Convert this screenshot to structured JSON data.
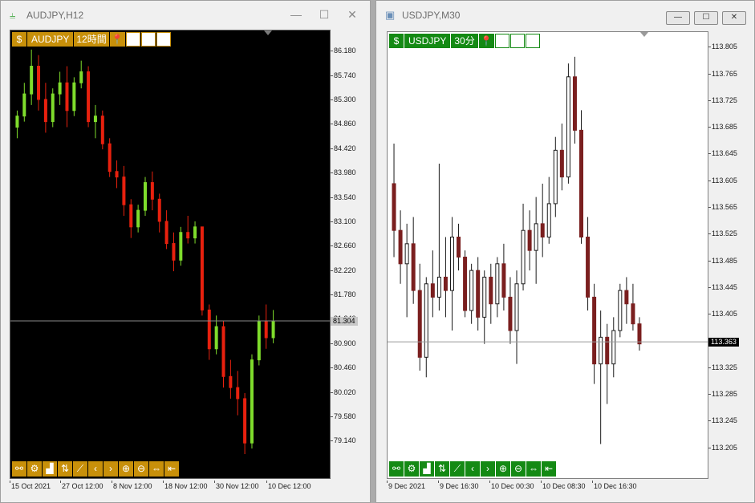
{
  "windows": [
    {
      "title": "AUDJPY,H12",
      "symbol": "AUDJPY",
      "timeframe": "12時間",
      "current_price": "81.304",
      "y_labels": [
        "86.180",
        "85.740",
        "85.300",
        "84.860",
        "84.420",
        "83.980",
        "83.540",
        "83.100",
        "82.660",
        "82.220",
        "81.780",
        "81.340",
        "80.900",
        "80.460",
        "80.020",
        "79.580",
        "79.140"
      ],
      "x_labels": [
        "15 Oct 2021",
        "27 Oct 12:00",
        "8 Nov 12:00",
        "18 Nov 12:00",
        "30 Nov 12:00",
        "10 Dec 12:00"
      ],
      "colors": {
        "bull": "#7fdc2c",
        "bear": "#e8210e",
        "bg": "#000000",
        "panel": "#c8900a"
      }
    },
    {
      "title": "USDJPY,M30",
      "symbol": "USDJPY",
      "timeframe": "30分",
      "current_price": "113.363",
      "y_labels": [
        "113.805",
        "113.765",
        "113.725",
        "113.685",
        "113.645",
        "113.605",
        "113.565",
        "113.525",
        "113.485",
        "113.445",
        "113.405",
        "113.365",
        "113.325",
        "113.285",
        "113.245",
        "113.205"
      ],
      "x_labels": [
        "9 Dec 2021",
        "9 Dec 16:30",
        "10 Dec 00:30",
        "10 Dec 08:30",
        "10 Dec 16:30"
      ],
      "colors": {
        "bull": "#ffffff",
        "bear": "#7a1f1f",
        "bg": "#ffffff",
        "panel": "#148a14"
      }
    }
  ],
  "window_controls": {
    "minimize": "—",
    "maximize": "☐",
    "close": "✕"
  },
  "toolbar_bottom": [
    "chart-objects",
    "settings",
    "bar-chart",
    "period-sep",
    "line-tool",
    "scroll-left",
    "scroll-right",
    "zoom-in",
    "zoom-out",
    "autoscroll",
    "shift-end"
  ],
  "chart_data": [
    {
      "type": "candlestick",
      "symbol": "AUDJPY",
      "timeframe": "H12",
      "ylim": [
        78.9,
        86.4
      ],
      "ohlc": [
        [
          84.8,
          85.1,
          84.6,
          85.0
        ],
        [
          85.0,
          85.6,
          84.9,
          85.4
        ],
        [
          85.4,
          86.2,
          85.2,
          85.9
        ],
        [
          85.9,
          86.1,
          85.1,
          85.3
        ],
        [
          85.3,
          85.6,
          84.7,
          84.9
        ],
        [
          84.9,
          85.5,
          84.8,
          85.4
        ],
        [
          85.4,
          85.8,
          85.2,
          85.6
        ],
        [
          85.6,
          85.9,
          84.8,
          85.1
        ],
        [
          85.1,
          85.7,
          85.0,
          85.6
        ],
        [
          85.6,
          86.0,
          85.5,
          85.8
        ],
        [
          85.8,
          85.9,
          84.8,
          84.9
        ],
        [
          84.9,
          85.2,
          84.6,
          85.0
        ],
        [
          85.0,
          85.1,
          84.4,
          84.5
        ],
        [
          84.5,
          84.6,
          83.9,
          84.0
        ],
        [
          84.0,
          84.2,
          83.7,
          83.9
        ],
        [
          83.9,
          84.1,
          83.2,
          83.4
        ],
        [
          83.4,
          83.5,
          82.8,
          83.0
        ],
        [
          83.0,
          83.4,
          82.9,
          83.3
        ],
        [
          83.3,
          83.9,
          83.2,
          83.8
        ],
        [
          83.8,
          84.0,
          83.3,
          83.5
        ],
        [
          83.5,
          83.6,
          82.9,
          83.1
        ],
        [
          83.1,
          83.3,
          82.6,
          82.7
        ],
        [
          82.7,
          82.9,
          82.2,
          82.4
        ],
        [
          82.4,
          83.0,
          82.3,
          82.9
        ],
        [
          82.9,
          83.2,
          82.7,
          82.8
        ],
        [
          82.8,
          83.1,
          82.7,
          83.0
        ],
        [
          83.0,
          83.0,
          81.4,
          81.5
        ],
        [
          81.5,
          81.6,
          80.6,
          80.8
        ],
        [
          80.8,
          81.4,
          80.7,
          81.2
        ],
        [
          81.2,
          81.3,
          80.1,
          80.3
        ],
        [
          80.3,
          80.6,
          79.9,
          80.1
        ],
        [
          80.1,
          80.4,
          79.6,
          79.9
        ],
        [
          79.9,
          80.0,
          78.9,
          79.1
        ],
        [
          79.1,
          80.7,
          79.0,
          80.6
        ],
        [
          80.6,
          81.4,
          80.5,
          81.3
        ],
        [
          81.3,
          81.6,
          80.8,
          81.0
        ],
        [
          81.0,
          81.5,
          80.9,
          81.3
        ]
      ]
    },
    {
      "type": "candlestick",
      "symbol": "USDJPY",
      "timeframe": "M30",
      "ylim": [
        113.195,
        113.815
      ],
      "ohlc": [
        [
          113.6,
          113.66,
          113.49,
          113.53
        ],
        [
          113.53,
          113.56,
          113.45,
          113.48
        ],
        [
          113.48,
          113.54,
          113.4,
          113.51
        ],
        [
          113.51,
          113.55,
          113.42,
          113.44
        ],
        [
          113.44,
          113.48,
          113.32,
          113.34
        ],
        [
          113.34,
          113.46,
          113.31,
          113.45
        ],
        [
          113.45,
          113.5,
          113.4,
          113.43
        ],
        [
          113.43,
          113.63,
          113.41,
          113.46
        ],
        [
          113.46,
          113.52,
          113.4,
          113.44
        ],
        [
          113.44,
          113.55,
          113.38,
          113.52
        ],
        [
          113.52,
          113.54,
          113.47,
          113.49
        ],
        [
          113.49,
          113.5,
          113.4,
          113.41
        ],
        [
          113.41,
          113.48,
          113.39,
          113.47
        ],
        [
          113.47,
          113.49,
          113.38,
          113.4
        ],
        [
          113.4,
          113.47,
          113.36,
          113.46
        ],
        [
          113.46,
          113.48,
          113.39,
          113.42
        ],
        [
          113.42,
          113.49,
          113.4,
          113.48
        ],
        [
          113.48,
          113.51,
          113.41,
          113.43
        ],
        [
          113.43,
          113.46,
          113.36,
          113.38
        ],
        [
          113.38,
          113.47,
          113.33,
          113.45
        ],
        [
          113.45,
          113.57,
          113.44,
          113.53
        ],
        [
          113.53,
          113.56,
          113.47,
          113.5
        ],
        [
          113.5,
          113.58,
          113.45,
          113.54
        ],
        [
          113.54,
          113.6,
          113.49,
          113.52
        ],
        [
          113.52,
          113.61,
          113.51,
          113.57
        ],
        [
          113.57,
          113.67,
          113.55,
          113.65
        ],
        [
          113.65,
          113.69,
          113.59,
          113.61
        ],
        [
          113.61,
          113.78,
          113.6,
          113.76
        ],
        [
          113.76,
          113.79,
          113.66,
          113.68
        ],
        [
          113.68,
          113.71,
          113.51,
          113.52
        ],
        [
          113.52,
          113.55,
          113.41,
          113.43
        ],
        [
          113.43,
          113.45,
          113.3,
          113.33
        ],
        [
          113.33,
          113.41,
          113.21,
          113.37
        ],
        [
          113.37,
          113.39,
          113.27,
          113.33
        ],
        [
          113.33,
          113.4,
          113.31,
          113.38
        ],
        [
          113.38,
          113.45,
          113.37,
          113.44
        ],
        [
          113.44,
          113.46,
          113.39,
          113.42
        ],
        [
          113.42,
          113.45,
          113.38,
          113.39
        ],
        [
          113.39,
          113.4,
          113.35,
          113.36
        ]
      ]
    }
  ]
}
